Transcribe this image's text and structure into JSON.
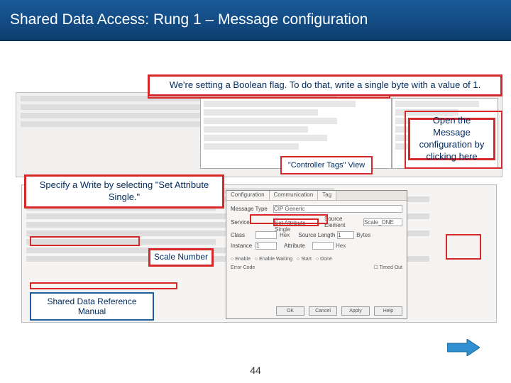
{
  "title": "Shared Data Access: Rung 1 – Message configuration",
  "callouts": {
    "boolean": "We're setting a Boolean flag.  To do that, write a single byte with a value of 1.",
    "specify": "Specify a Write by selecting \"Set Attribute Single.\"",
    "openmsg": "Open the Message configuration by clicking here",
    "ctrltags": "\"Controller Tags\" View",
    "scalenum": "Scale Number",
    "manual": "Shared Data Reference Manual"
  },
  "dialog": {
    "tabs": [
      "Configuration",
      "Communication",
      "Tag"
    ],
    "labels": {
      "msgtype": "Message Type",
      "service": "Service",
      "class": "Class",
      "instance": "Instance",
      "attribute": "Attribute",
      "srcelem": "Source Element",
      "srclen": "Source Length"
    },
    "values": {
      "msgtype": "CIP Generic",
      "service": "Set Attribute Single",
      "class": "Hex",
      "instance": "1",
      "attribute": "Hex",
      "srcelem": "Scale_ONE",
      "srclen": "1",
      "srclen_unit": "Bytes"
    },
    "buttons": {
      "ok": "OK",
      "cancel": "Cancel",
      "apply": "Apply",
      "help": "Help"
    },
    "checks": [
      "Enable",
      "Enable Waiting",
      "Start",
      "Done",
      "Timed Out"
    ],
    "err": "Error Code"
  },
  "page_number": "44"
}
